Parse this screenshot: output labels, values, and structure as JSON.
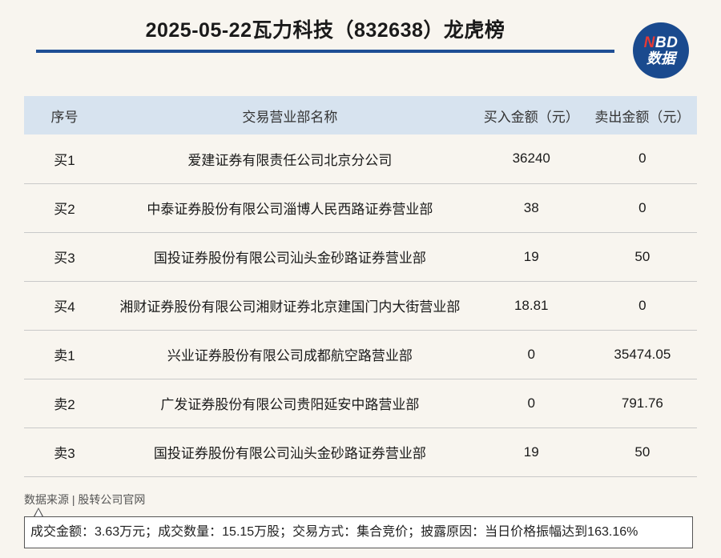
{
  "header": {
    "title": "2025-05-22瓦力科技（832638）龙虎榜",
    "logo_top": "NBD",
    "logo_bottom": "数据"
  },
  "colors": {
    "accent": "#1f4e95",
    "header_row": "#d7e3ef",
    "logo_bg": "#1a4a8e",
    "logo_n": "#e53935",
    "background": "#f8f5ef"
  },
  "table": {
    "headers": [
      "序号",
      "交易营业部名称",
      "买入金额（元）",
      "卖出金额（元）"
    ],
    "rows": [
      [
        "买1",
        "爱建证券有限责任公司北京分公司",
        "36240",
        "0"
      ],
      [
        "买2",
        "中泰证券股份有限公司淄博人民西路证券营业部",
        "38",
        "0"
      ],
      [
        "买3",
        "国投证券股份有限公司汕头金砂路证券营业部",
        "19",
        "50"
      ],
      [
        "买4",
        "湘财证券股份有限公司湘财证券北京建国门内大街营业部",
        "18.81",
        "0"
      ],
      [
        "卖1",
        "兴业证券股份有限公司成都航空路营业部",
        "0",
        "35474.05"
      ],
      [
        "卖2",
        "广发证券股份有限公司贵阳延安中路营业部",
        "0",
        "791.76"
      ],
      [
        "卖3",
        "国投证券股份有限公司汕头金砂路证券营业部",
        "19",
        "50"
      ]
    ]
  },
  "footer": {
    "source": "数据来源 | 股转公司官网",
    "note": "成交金额：3.63万元；成交数量：15.15万股；交易方式：集合竞价；披露原因：当日价格振幅达到163.16%"
  }
}
